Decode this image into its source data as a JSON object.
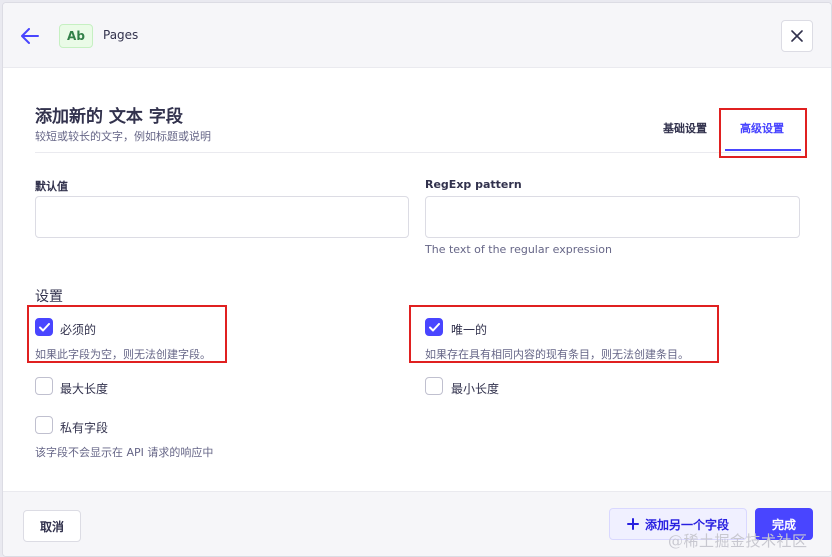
{
  "header": {
    "type_badge": "Ab",
    "breadcrumb": "Pages"
  },
  "form": {
    "title": "添加新的 文本 字段",
    "subtitle": "较短或较长的文字，例如标题或说明",
    "tabs": [
      {
        "label": "基础设置",
        "active": false
      },
      {
        "label": "高级设置",
        "active": true
      }
    ],
    "default_value": {
      "label": "默认值",
      "value": ""
    },
    "regexp": {
      "label": "RegExp pattern",
      "value": "",
      "hint": "The text of the regular expression"
    },
    "settings_title": "设置",
    "checkboxes": {
      "required": {
        "label": "必须的",
        "checked": true,
        "hint": "如果此字段为空，则无法创建字段。"
      },
      "unique": {
        "label": "唯一的",
        "checked": true,
        "hint": "如果存在具有相同内容的现有条目，则无法创建条目。"
      },
      "max_length": {
        "label": "最大长度",
        "checked": false
      },
      "min_length": {
        "label": "最小长度",
        "checked": false
      },
      "private": {
        "label": "私有字段",
        "checked": false,
        "hint": "该字段不会显示在 API 请求的响应中"
      }
    }
  },
  "footer": {
    "cancel": "取消",
    "add_another": "添加另一个字段",
    "finish": "完成"
  },
  "watermark": "@稀土掘金技术社区",
  "colors": {
    "primary": "#4945ff",
    "highlight": "#e02020",
    "badge_green": "#328048"
  },
  "icons": [
    "arrow-left-icon",
    "close-icon",
    "check-icon",
    "plus-icon"
  ]
}
